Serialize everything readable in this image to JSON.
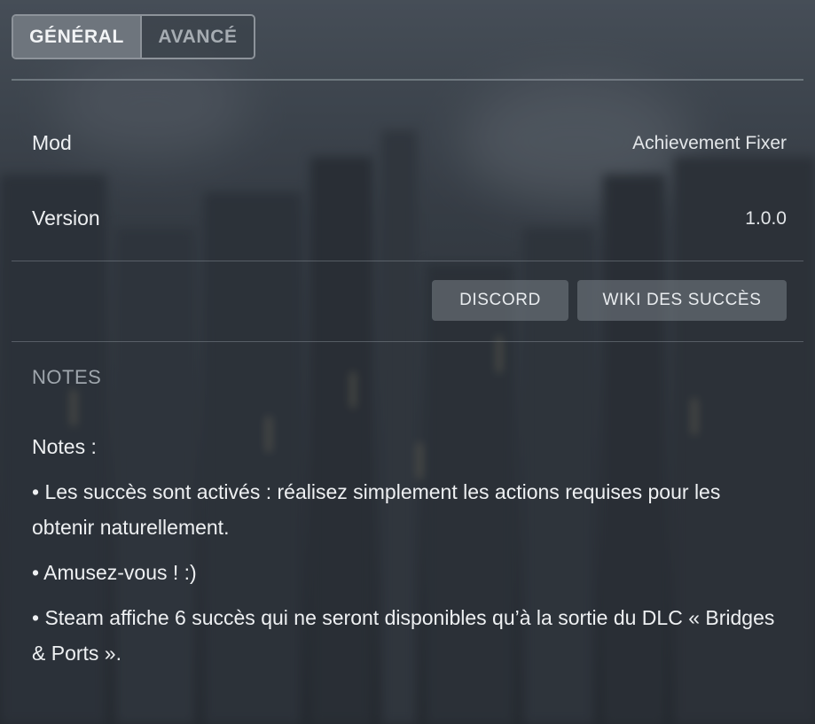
{
  "tabs": [
    {
      "label": "GÉNÉRAL",
      "active": true
    },
    {
      "label": "AVANCÉ",
      "active": false
    }
  ],
  "info": {
    "mod_label": "Mod",
    "mod_value": "Achievement Fixer",
    "version_label": "Version",
    "version_value": "1.0.0"
  },
  "buttons": {
    "discord": "DISCORD",
    "wiki": "WIKI DES SUCCÈS"
  },
  "notes_section": {
    "title": "NOTES",
    "heading": "Notes :",
    "lines": [
      "• Les succès sont activés : réalisez simplement les actions requises pour les obtenir naturellement.",
      "• Amusez-vous ! :)",
      "• Steam affiche 6 succès qui ne seront disponibles qu’à la sortie du DLC « Bridges & Ports »."
    ]
  },
  "colors": {
    "accent_tab": "#6e757d",
    "button_bg": "#6f767e",
    "text": "#eef0f2",
    "muted": "#9fa6ad"
  }
}
